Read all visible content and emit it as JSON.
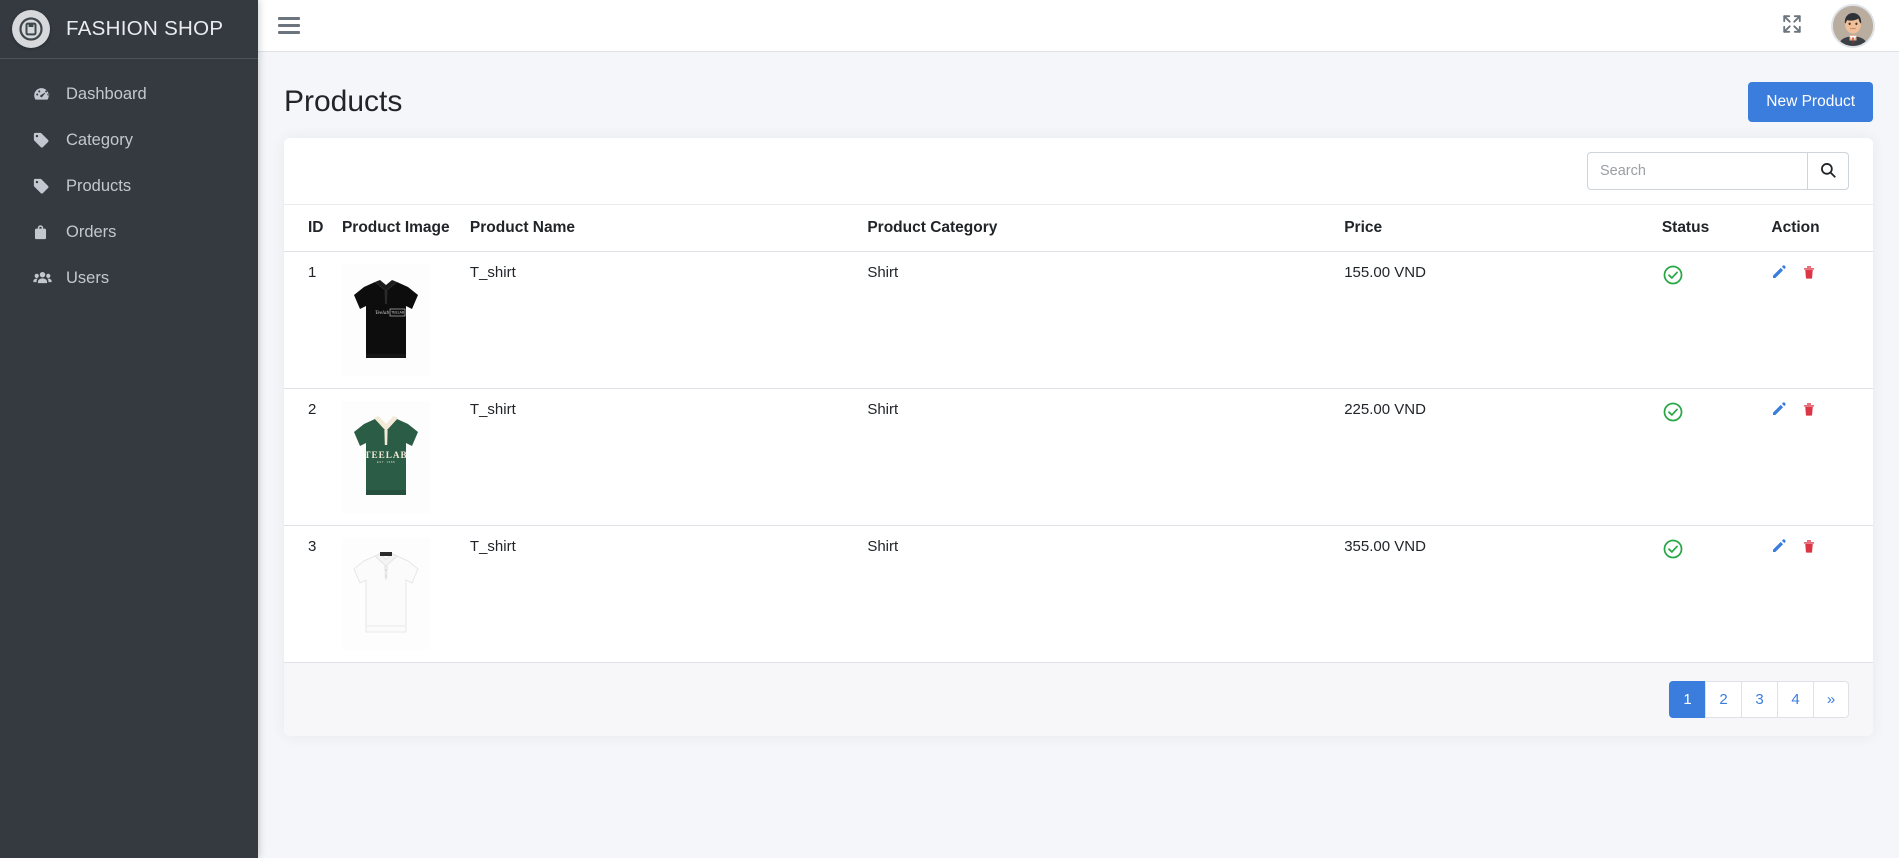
{
  "brand": {
    "title": "FASHION SHOP",
    "logo_icon": "app-badge-icon"
  },
  "sidebar": {
    "items": [
      {
        "label": "Dashboard",
        "icon": "dashboard-gauge-icon"
      },
      {
        "label": "Category",
        "icon": "tag-icon"
      },
      {
        "label": "Products",
        "icon": "tag-icon"
      },
      {
        "label": "Orders",
        "icon": "briefcase-icon"
      },
      {
        "label": "Users",
        "icon": "users-icon"
      }
    ]
  },
  "topbar": {
    "menu_toggle_icon": "hamburger-icon",
    "fullscreen_icon": "expand-arrows-icon",
    "avatar_icon": "user-avatar"
  },
  "page": {
    "title": "Products",
    "new_product_label": "New Product"
  },
  "search": {
    "placeholder": "Search",
    "value": "",
    "button_icon": "search-icon"
  },
  "table": {
    "columns": [
      "ID",
      "Product Image",
      "Product Name",
      "Product Category",
      "Price",
      "Status",
      "Action"
    ],
    "rows": [
      {
        "id": "1",
        "image_alt": "black-polo-shirt",
        "name": "T_shirt",
        "category": "Shirt",
        "price": "155.00 VND",
        "status": "active",
        "status_icon": "check-circle-icon",
        "edit_icon": "pencil-icon",
        "delete_icon": "trash-icon"
      },
      {
        "id": "2",
        "image_alt": "green-teelab-polo-shirt",
        "name": "T_shirt",
        "category": "Shirt",
        "price": "225.00 VND",
        "status": "active",
        "status_icon": "check-circle-icon",
        "edit_icon": "pencil-icon",
        "delete_icon": "trash-icon"
      },
      {
        "id": "3",
        "image_alt": "white-polo-shirt",
        "name": "T_shirt",
        "category": "Shirt",
        "price": "355.00 VND",
        "status": "active",
        "status_icon": "check-circle-icon",
        "edit_icon": "pencil-icon",
        "delete_icon": "trash-icon"
      }
    ]
  },
  "pagination": {
    "pages": [
      "1",
      "2",
      "3",
      "4"
    ],
    "next_label": "»",
    "active": "1"
  },
  "colors": {
    "sidebar_bg": "#343a40",
    "accent_blue": "#3b7ddd",
    "status_green": "#28a745",
    "delete_red": "#dc3545",
    "content_bg": "#f4f6f9"
  }
}
